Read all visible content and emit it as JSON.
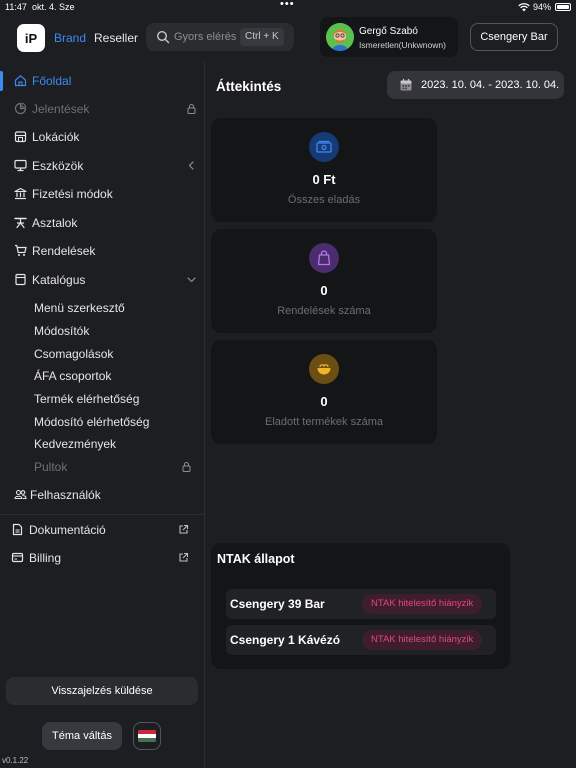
{
  "status_bar": {
    "time": "11:47",
    "date": "okt. 4. Sze",
    "dots": "•••",
    "battery": "94%"
  },
  "header": {
    "logo_text": "iP",
    "brand_label": "Brand",
    "reseller_label": "Reseller",
    "search_placeholder": "Gyors elérés",
    "search_shortcut": "Ctrl + K",
    "user_name": "Gergő Szabó",
    "user_role": "Ismeretlen(Unkwnown)",
    "venue_button": "Csengery Bar"
  },
  "sidebar": {
    "items": [
      {
        "label": "Főoldal",
        "icon": "home-icon",
        "active": true
      },
      {
        "label": "Jelentések",
        "icon": "chart-icon",
        "disabled": true,
        "trail": "lock-icon"
      },
      {
        "label": "Lokációk",
        "icon": "store-icon"
      },
      {
        "label": "Eszközök",
        "icon": "monitor-icon",
        "trail": "chevron-left-icon"
      },
      {
        "label": "Fizetési módok",
        "icon": "bank-icon"
      },
      {
        "label": "Asztalok",
        "icon": "table-icon"
      },
      {
        "label": "Rendelések",
        "icon": "cart-icon"
      },
      {
        "label": "Katalógus",
        "icon": "book-icon",
        "trail": "chevron-down-icon"
      }
    ],
    "catalog_subitems": [
      "Menü szerkesztő",
      "Módosítók",
      "Csomagolások",
      "ÁFA csoportok",
      "Termék elérhetőség",
      "Módosító elérhetőség",
      "Kedvezmények",
      "Pultok"
    ],
    "users_label": "Felhasználók",
    "docs_label": "Dokumentáció",
    "billing_label": "Billing",
    "feedback_button": "Visszajelzés küldése",
    "theme_button": "Téma váltás",
    "version": "v0.1.22"
  },
  "main": {
    "title": "Áttekintés",
    "date_range": "2023. 10. 04. - 2023. 10. 04.",
    "stats": [
      {
        "value": "0 Ft",
        "caption": "Összes eladás",
        "icon": "cash-icon",
        "color": "#2f6fd0"
      },
      {
        "value": "0",
        "caption": "Rendelések száma",
        "icon": "bag-icon",
        "color": "#8a4fc5"
      },
      {
        "value": "0",
        "caption": "Eladott termékek száma",
        "icon": "bowl-icon",
        "color": "#c8941e"
      }
    ],
    "ntak": {
      "title": "NTAK állapot",
      "rows": [
        {
          "name": "Csengery 39 Bar",
          "status": "NTAK hitelesítő hiányzik"
        },
        {
          "name": "Csengery 1 Kávézó",
          "status": "NTAK hitelesítő hiányzik"
        }
      ]
    }
  },
  "colors": {
    "accent": "#3d8bf0",
    "background": "#1d1e21",
    "card": "#141517",
    "error_badge_text": "#e0497a"
  }
}
